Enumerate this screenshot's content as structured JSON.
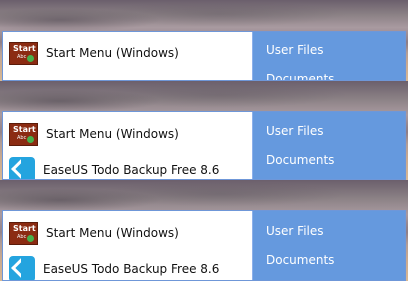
{
  "menu_frames": [
    {
      "programs": [
        {
          "label": "Start Menu (Windows)",
          "icon": "start-menu-icon",
          "icon_text": "Start",
          "icon_subtext": "Abc"
        }
      ],
      "places": [
        "User Files",
        "Documents"
      ]
    },
    {
      "programs": [
        {
          "label": "Start Menu (Windows)",
          "icon": "start-menu-icon",
          "icon_text": "Start",
          "icon_subtext": "Abc"
        },
        {
          "label": "EaseUS Todo Backup Free 8.6",
          "icon": "easeus-icon"
        }
      ],
      "places": [
        "User Files",
        "Documents"
      ]
    },
    {
      "programs": [
        {
          "label": "Start Menu (Windows)",
          "icon": "start-menu-icon",
          "icon_text": "Start",
          "icon_subtext": "Abc"
        },
        {
          "label": "EaseUS Todo Backup Free 8.6",
          "icon": "easeus-icon"
        }
      ],
      "places": [
        "User Files",
        "Documents"
      ]
    }
  ],
  "colors": {
    "panel_border": "#6f97d8",
    "places_background": "#6599de",
    "start_icon": "#8b2b12",
    "easeus_icon": "#24a4df"
  }
}
